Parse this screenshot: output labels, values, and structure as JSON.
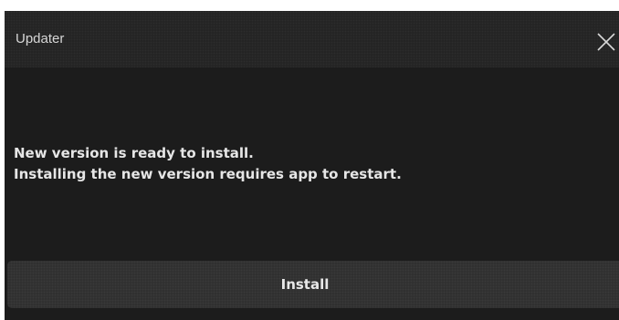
{
  "window": {
    "title": "Updater",
    "close_icon": "close-icon"
  },
  "message": {
    "line1": "New version is ready to install.",
    "line2": "Installing the new version requires app to restart."
  },
  "actions": {
    "install_label": "Install"
  },
  "colors": {
    "background": "#1c1c1c",
    "titlebar": "#222222",
    "button": "#2e2e2e",
    "text": "#e6e6e6"
  }
}
